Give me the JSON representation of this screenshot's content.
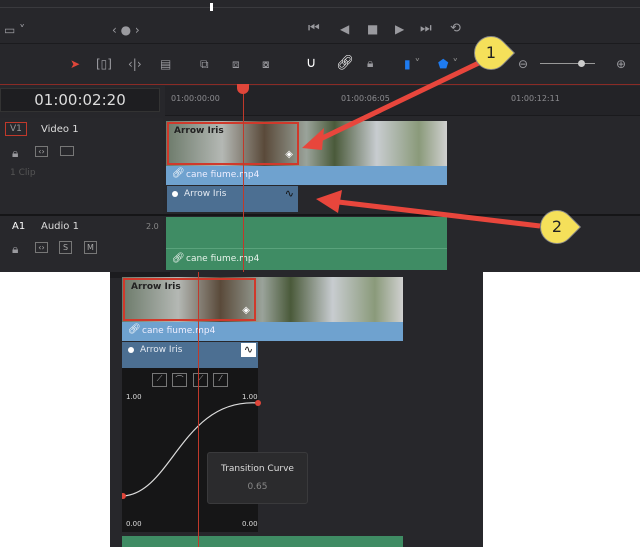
{
  "viewer": {
    "timecode": "01:00:02:20"
  },
  "ruler": {
    "ticks": [
      "01:00:00:00",
      "01:00:06:05",
      "01:00:12:11"
    ]
  },
  "tracks": {
    "video": {
      "id": "V1",
      "name": "Video 1",
      "clips_count": "1 Clip"
    },
    "audio": {
      "id": "A1",
      "name": "Audio 1",
      "channels": "2.0",
      "solo": "S",
      "mute": "M"
    }
  },
  "clip": {
    "transition_name": "Arrow Iris",
    "file_name": "cane fiume.mp4"
  },
  "callouts": [
    "1",
    "2"
  ],
  "curve_editor": {
    "top_left": "1.00",
    "top_right": "1.00",
    "bottom_left": "0.00",
    "bottom_right": "0.00"
  },
  "tooltip": {
    "title": "Transition Curve",
    "value": "0.65"
  },
  "colors": {
    "accent_red": "#e0463a",
    "clip_blue": "#6fa2cf",
    "transition_blue": "#4c6f92",
    "audio_green": "#3f8c64",
    "callout_yellow": "#f5e05a"
  }
}
